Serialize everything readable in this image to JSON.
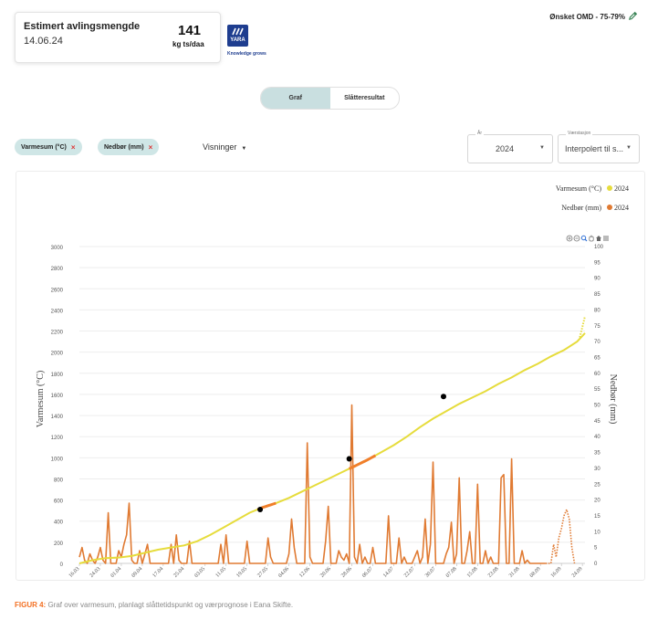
{
  "estimate_card": {
    "label": "Estimert avlingsmengde",
    "date": "14.06.24",
    "value": "141",
    "unit": "kg ts/daa"
  },
  "brand": {
    "logo_text": "YARA",
    "tagline": "Knowledge grows",
    "color": "#1e3d8f"
  },
  "omd": {
    "label": "Ønsket OMD - 75-79%"
  },
  "view_toggle": [
    {
      "label": "Graf",
      "active": true
    },
    {
      "label": "Slåtteresultat",
      "active": false
    }
  ],
  "filters": {
    "chips": [
      {
        "label": "Varmesum (°C)"
      },
      {
        "label": "Nedbør (mm)"
      }
    ],
    "chip_remove": "×",
    "views_label": "Visninger"
  },
  "year_select": {
    "legend": "År",
    "value": "2024"
  },
  "station_select": {
    "legend": "Værstasjon",
    "value": "Interpolert til s..."
  },
  "chart_toolbar": [
    "zoom-in-icon",
    "zoom-out-icon",
    "magnifier-icon",
    "pan-hand-icon",
    "home-icon",
    "menu-icon"
  ],
  "caption": {
    "prefix": "FIGUR 4:",
    "text": " Graf over varmesum, planlagt slåttetidspunkt og værprognose i Eana Skifte."
  },
  "chart_data": {
    "type": "line",
    "ylabel": "Varmesum (°C)",
    "y2label": "Nedbør (mm)",
    "ylim": [
      0,
      3000
    ],
    "y2lim": [
      0,
      100
    ],
    "yticks": [
      0,
      200,
      400,
      600,
      800,
      1000,
      1200,
      1400,
      1600,
      1800,
      2000,
      2200,
      2400,
      2600,
      2800,
      3000
    ],
    "y2ticks": [
      0,
      5,
      10,
      15,
      20,
      25,
      30,
      35,
      40,
      45,
      50,
      55,
      60,
      65,
      70,
      75,
      80,
      85,
      90,
      95,
      100
    ],
    "xlim": [
      0,
      193
    ],
    "xtick_labels": [
      "16.03",
      "24.03",
      "01.04",
      "09.04",
      "17.04",
      "25.04",
      "03.05",
      "11.05",
      "19.05",
      "27.05",
      "04.06",
      "12.06",
      "20.06",
      "28.06",
      "06.07",
      "14.07",
      "22.07",
      "30.07",
      "07.08",
      "15.08",
      "23.08",
      "31.08",
      "08.09",
      "16.09",
      "24.09"
    ],
    "xtick_positions": [
      0,
      8,
      16,
      24,
      32,
      40,
      48,
      56,
      64,
      72,
      80,
      88,
      96,
      104,
      112,
      120,
      128,
      136,
      144,
      152,
      160,
      168,
      176,
      184,
      192
    ],
    "legend": [
      {
        "name": "Varmesum (°C)",
        "year": "2024",
        "color": "#e6dc3c"
      },
      {
        "name": "Nedbør (mm)",
        "year": "2024",
        "color": "#e07a32"
      }
    ],
    "varmesum_points": [
      [
        0,
        0
      ],
      [
        5,
        30
      ],
      [
        10,
        50
      ],
      [
        15,
        55
      ],
      [
        20,
        70
      ],
      [
        25,
        100
      ],
      [
        30,
        130
      ],
      [
        35,
        150
      ],
      [
        40,
        170
      ],
      [
        45,
        210
      ],
      [
        50,
        270
      ],
      [
        55,
        340
      ],
      [
        60,
        410
      ],
      [
        65,
        480
      ],
      [
        70,
        530
      ],
      [
        75,
        570
      ],
      [
        80,
        620
      ],
      [
        85,
        680
      ],
      [
        90,
        740
      ],
      [
        95,
        800
      ],
      [
        100,
        860
      ],
      [
        105,
        920
      ],
      [
        110,
        980
      ],
      [
        115,
        1050
      ],
      [
        120,
        1120
      ],
      [
        125,
        1200
      ],
      [
        130,
        1290
      ],
      [
        135,
        1370
      ],
      [
        140,
        1440
      ],
      [
        145,
        1510
      ],
      [
        150,
        1570
      ],
      [
        155,
        1630
      ],
      [
        160,
        1700
      ],
      [
        165,
        1760
      ],
      [
        170,
        1830
      ],
      [
        175,
        1890
      ],
      [
        180,
        1960
      ],
      [
        185,
        2020
      ],
      [
        190,
        2100
      ],
      [
        193,
        2180
      ]
    ],
    "forecast_segments": [
      [
        68,
        75
      ],
      [
        103,
        113
      ]
    ],
    "varmesum_forecast_tail": [
      [
        191,
        2140
      ],
      [
        193,
        2340
      ]
    ],
    "harvest_markers": [
      [
        69,
        510
      ],
      [
        103,
        990
      ],
      [
        139,
        1580
      ]
    ],
    "nedbor_points": [
      [
        0,
        2
      ],
      [
        1,
        5
      ],
      [
        2,
        1
      ],
      [
        3,
        0
      ],
      [
        4,
        3
      ],
      [
        5,
        1
      ],
      [
        6,
        0
      ],
      [
        7,
        2
      ],
      [
        8,
        5
      ],
      [
        9,
        1
      ],
      [
        10,
        0
      ],
      [
        11,
        16
      ],
      [
        12,
        0
      ],
      [
        13,
        0
      ],
      [
        14,
        0
      ],
      [
        15,
        4
      ],
      [
        16,
        2
      ],
      [
        17,
        6
      ],
      [
        18,
        9
      ],
      [
        19,
        19
      ],
      [
        20,
        1
      ],
      [
        21,
        0
      ],
      [
        22,
        0
      ],
      [
        23,
        4
      ],
      [
        24,
        0
      ],
      [
        25,
        3
      ],
      [
        26,
        6
      ],
      [
        27,
        0
      ],
      [
        28,
        0
      ],
      [
        29,
        0
      ],
      [
        30,
        0
      ],
      [
        31,
        0
      ],
      [
        32,
        0
      ],
      [
        33,
        0
      ],
      [
        34,
        0
      ],
      [
        35,
        6
      ],
      [
        36,
        0
      ],
      [
        37,
        9
      ],
      [
        38,
        1
      ],
      [
        39,
        0
      ],
      [
        40,
        0
      ],
      [
        41,
        0
      ],
      [
        42,
        7
      ],
      [
        43,
        0
      ],
      [
        44,
        0
      ],
      [
        45,
        0
      ],
      [
        46,
        0
      ],
      [
        47,
        0
      ],
      [
        48,
        0
      ],
      [
        49,
        0
      ],
      [
        50,
        0
      ],
      [
        51,
        0
      ],
      [
        52,
        0
      ],
      [
        53,
        0
      ],
      [
        54,
        6
      ],
      [
        55,
        0
      ],
      [
        56,
        9
      ],
      [
        57,
        0
      ],
      [
        58,
        0
      ],
      [
        59,
        0
      ],
      [
        60,
        0
      ],
      [
        61,
        0
      ],
      [
        62,
        0
      ],
      [
        63,
        0
      ],
      [
        64,
        7
      ],
      [
        65,
        0
      ],
      [
        66,
        0
      ],
      [
        67,
        0
      ],
      [
        68,
        0
      ],
      [
        69,
        0
      ],
      [
        70,
        0
      ],
      [
        71,
        0
      ],
      [
        72,
        8
      ],
      [
        73,
        2
      ],
      [
        74,
        0
      ],
      [
        75,
        0
      ],
      [
        76,
        0
      ],
      [
        77,
        0
      ],
      [
        78,
        0
      ],
      [
        79,
        0
      ],
      [
        80,
        3
      ],
      [
        81,
        14
      ],
      [
        82,
        5
      ],
      [
        83,
        0
      ],
      [
        84,
        0
      ],
      [
        85,
        0
      ],
      [
        86,
        0
      ],
      [
        87,
        38
      ],
      [
        88,
        2
      ],
      [
        89,
        0
      ],
      [
        90,
        0
      ],
      [
        91,
        0
      ],
      [
        92,
        0
      ],
      [
        93,
        0
      ],
      [
        94,
        7
      ],
      [
        95,
        18
      ],
      [
        96,
        0
      ],
      [
        97,
        0
      ],
      [
        98,
        0
      ],
      [
        99,
        4
      ],
      [
        100,
        2
      ],
      [
        101,
        1
      ],
      [
        102,
        3
      ],
      [
        103,
        0
      ],
      [
        104,
        50
      ],
      [
        105,
        2
      ],
      [
        106,
        0
      ],
      [
        107,
        6
      ],
      [
        108,
        0
      ],
      [
        109,
        2
      ],
      [
        110,
        0
      ],
      [
        111,
        0
      ],
      [
        112,
        5
      ],
      [
        113,
        0
      ],
      [
        114,
        0
      ],
      [
        115,
        0
      ],
      [
        116,
        0
      ],
      [
        117,
        0
      ],
      [
        118,
        15
      ],
      [
        119,
        0
      ],
      [
        120,
        0
      ],
      [
        121,
        0
      ],
      [
        122,
        8
      ],
      [
        123,
        0
      ],
      [
        124,
        2
      ],
      [
        125,
        0
      ],
      [
        126,
        0
      ],
      [
        127,
        0
      ],
      [
        128,
        2
      ],
      [
        129,
        4
      ],
      [
        130,
        0
      ],
      [
        131,
        2
      ],
      [
        132,
        14
      ],
      [
        133,
        0
      ],
      [
        134,
        6
      ],
      [
        135,
        32
      ],
      [
        136,
        0
      ],
      [
        137,
        0
      ],
      [
        138,
        0
      ],
      [
        139,
        0
      ],
      [
        140,
        3
      ],
      [
        141,
        5
      ],
      [
        142,
        13
      ],
      [
        143,
        0
      ],
      [
        144,
        3
      ],
      [
        145,
        27
      ],
      [
        146,
        0
      ],
      [
        147,
        0
      ],
      [
        148,
        4
      ],
      [
        149,
        10
      ],
      [
        150,
        0
      ],
      [
        151,
        0
      ],
      [
        152,
        25
      ],
      [
        153,
        0
      ],
      [
        154,
        0
      ],
      [
        155,
        4
      ],
      [
        156,
        0
      ],
      [
        157,
        2
      ],
      [
        158,
        0
      ],
      [
        159,
        0
      ],
      [
        160,
        0
      ],
      [
        161,
        27
      ],
      [
        162,
        28
      ],
      [
        163,
        0
      ],
      [
        164,
        0
      ],
      [
        165,
        33
      ],
      [
        166,
        0
      ],
      [
        167,
        0
      ],
      [
        168,
        0
      ],
      [
        169,
        4
      ],
      [
        170,
        0
      ],
      [
        171,
        1
      ],
      [
        172,
        0
      ],
      [
        173,
        0
      ],
      [
        174,
        0
      ],
      [
        175,
        0
      ],
      [
        176,
        0
      ],
      [
        177,
        0
      ],
      [
        178,
        0
      ]
    ],
    "nedbor_forecast": [
      [
        178,
        0
      ],
      [
        180,
        0
      ],
      [
        181,
        6
      ],
      [
        182,
        2
      ],
      [
        183,
        8
      ],
      [
        184,
        11
      ],
      [
        185,
        15
      ],
      [
        186,
        17
      ],
      [
        187,
        14
      ],
      [
        188,
        5
      ],
      [
        189,
        0
      ]
    ]
  }
}
